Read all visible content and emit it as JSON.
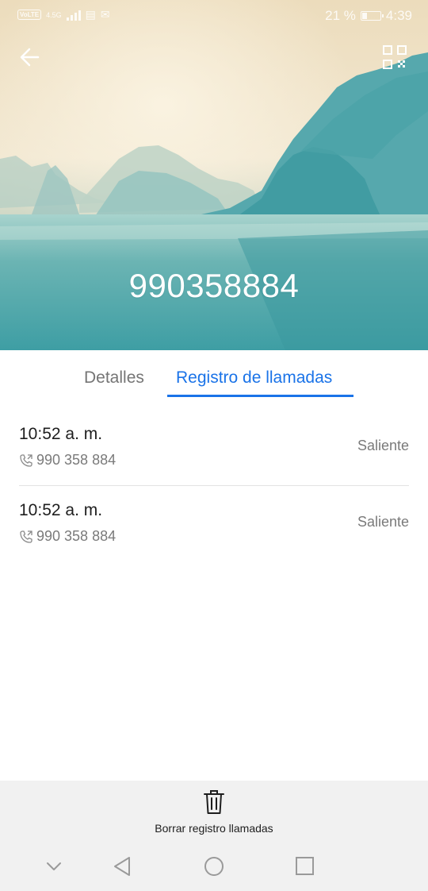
{
  "status_bar": {
    "volte": "VoLTE",
    "network": "4.5G",
    "battery": "21 %",
    "time": "4:39"
  },
  "header": {
    "phone_number": "990358884",
    "back_icon": "arrow-left-icon",
    "qr_icon": "qr-code-icon"
  },
  "tabs": [
    {
      "label": "Detalles",
      "active": false
    },
    {
      "label": "Registro de llamadas",
      "active": true
    }
  ],
  "call_log": [
    {
      "time": "10:52 a. m.",
      "number": "990 358 884",
      "type": "Saliente",
      "icon": "outgoing-call-icon"
    },
    {
      "time": "10:52 a. m.",
      "number": "990 358 884",
      "type": "Saliente",
      "icon": "outgoing-call-icon"
    }
  ],
  "bottom_action": {
    "label": "Borrar registro llamadas",
    "icon": "trash-icon"
  },
  "colors": {
    "accent": "#1a73e8",
    "hero_sky": "#f1e6cc",
    "hero_water": "#4aa3a8"
  }
}
